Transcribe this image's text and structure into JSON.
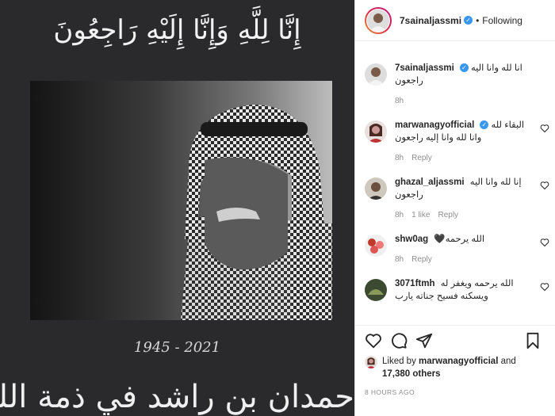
{
  "post": {
    "verse": "إِنَّا لِلَّهِ وَإِنَّا إِلَيْهِ رَاجِعُونَ",
    "years": "1945 - 2021",
    "name_calligraphy": "حمدان بن راشد في ذمة الله"
  },
  "header": {
    "username": "7sainaljassmi",
    "separator": "•",
    "follow_label": "Following"
  },
  "comments": [
    {
      "user": "7sainaljassmi",
      "verified": true,
      "text": "انا لله وانا اليه راجعون",
      "time": "8h",
      "likes": "",
      "reply": ""
    },
    {
      "user": "marwanagyofficial",
      "verified": true,
      "text": "البقاء لله وانا لله وانا إليه راجعون",
      "time": "8h",
      "likes": "",
      "reply": "Reply"
    },
    {
      "user": "ghazal_aljassmi",
      "verified": false,
      "text": "إنا لله وانا اليه راجعون",
      "time": "8h",
      "likes": "1 like",
      "reply": "Reply"
    },
    {
      "user": "shw0ag",
      "verified": false,
      "text": "الله يرحمه🖤",
      "time": "8h",
      "likes": "",
      "reply": "Reply"
    },
    {
      "user": "3071ftmh",
      "verified": false,
      "text": "الله يرحمه ويغفر له ويسكنه فسيح جناته يارب",
      "time": "",
      "likes": "",
      "reply": ""
    }
  ],
  "likes": {
    "prefix": "Liked by",
    "user": "marwanagyofficial",
    "and": "and",
    "count": "17,380 others"
  },
  "timestamp": "8 HOURS AGO",
  "icons": {
    "like": "heart-icon",
    "comment": "comment-icon",
    "share": "share-icon",
    "save": "bookmark-icon"
  },
  "colors": {
    "verified": "#3897f0",
    "story_ring_start": "#f09433",
    "story_ring_end": "#bc1888"
  }
}
